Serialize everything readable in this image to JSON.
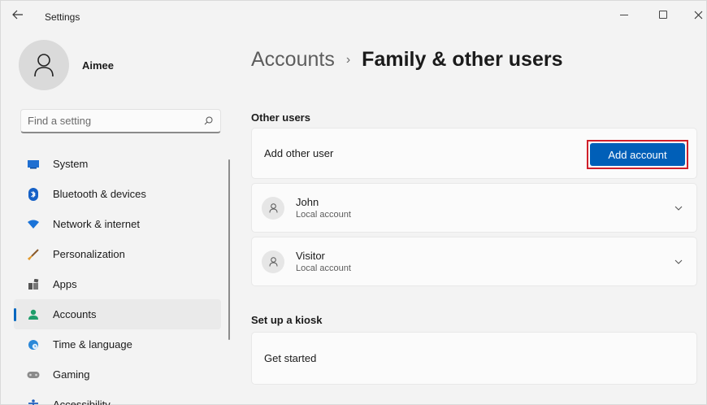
{
  "window": {
    "title": "Settings",
    "minimize_icon": "minimize-icon",
    "maximize_icon": "maximize-icon",
    "close_icon": "close-icon"
  },
  "profile": {
    "name": "Aimee"
  },
  "search": {
    "placeholder": "Find a setting"
  },
  "sidebar": {
    "items": [
      {
        "label": "System",
        "icon": "monitor-icon",
        "color": "#1f6fd1"
      },
      {
        "label": "Bluetooth & devices",
        "icon": "bluetooth-icon",
        "color": "#1560c6"
      },
      {
        "label": "Network & internet",
        "icon": "wifi-icon",
        "color": "#1a73d8"
      },
      {
        "label": "Personalization",
        "icon": "brush-icon",
        "color": "#e39a2d"
      },
      {
        "label": "Apps",
        "icon": "apps-icon",
        "color": "#555555"
      },
      {
        "label": "Accounts",
        "icon": "person-icon",
        "color": "#1f9d6b",
        "active": true
      },
      {
        "label": "Time & language",
        "icon": "globe-clock-icon",
        "color": "#2b88d8"
      },
      {
        "label": "Gaming",
        "icon": "gamepad-icon",
        "color": "#8a8a8a"
      },
      {
        "label": "Accessibility",
        "icon": "accessibility-icon",
        "color": "#1f5fbf"
      }
    ]
  },
  "breadcrumb": {
    "parent": "Accounts",
    "separator": "›",
    "current": "Family & other users"
  },
  "other_users": {
    "section_title": "Other users",
    "add_label": "Add other user",
    "add_button": "Add account",
    "users": [
      {
        "name": "John",
        "type": "Local account"
      },
      {
        "name": "Visitor",
        "type": "Local account"
      }
    ]
  },
  "kiosk": {
    "section_title": "Set up a kiosk",
    "label": "Get started"
  },
  "colors": {
    "accent": "#005fb8",
    "highlight_border": "#d0202a",
    "background": "#f3f3f3",
    "card": "#fbfbfb"
  }
}
